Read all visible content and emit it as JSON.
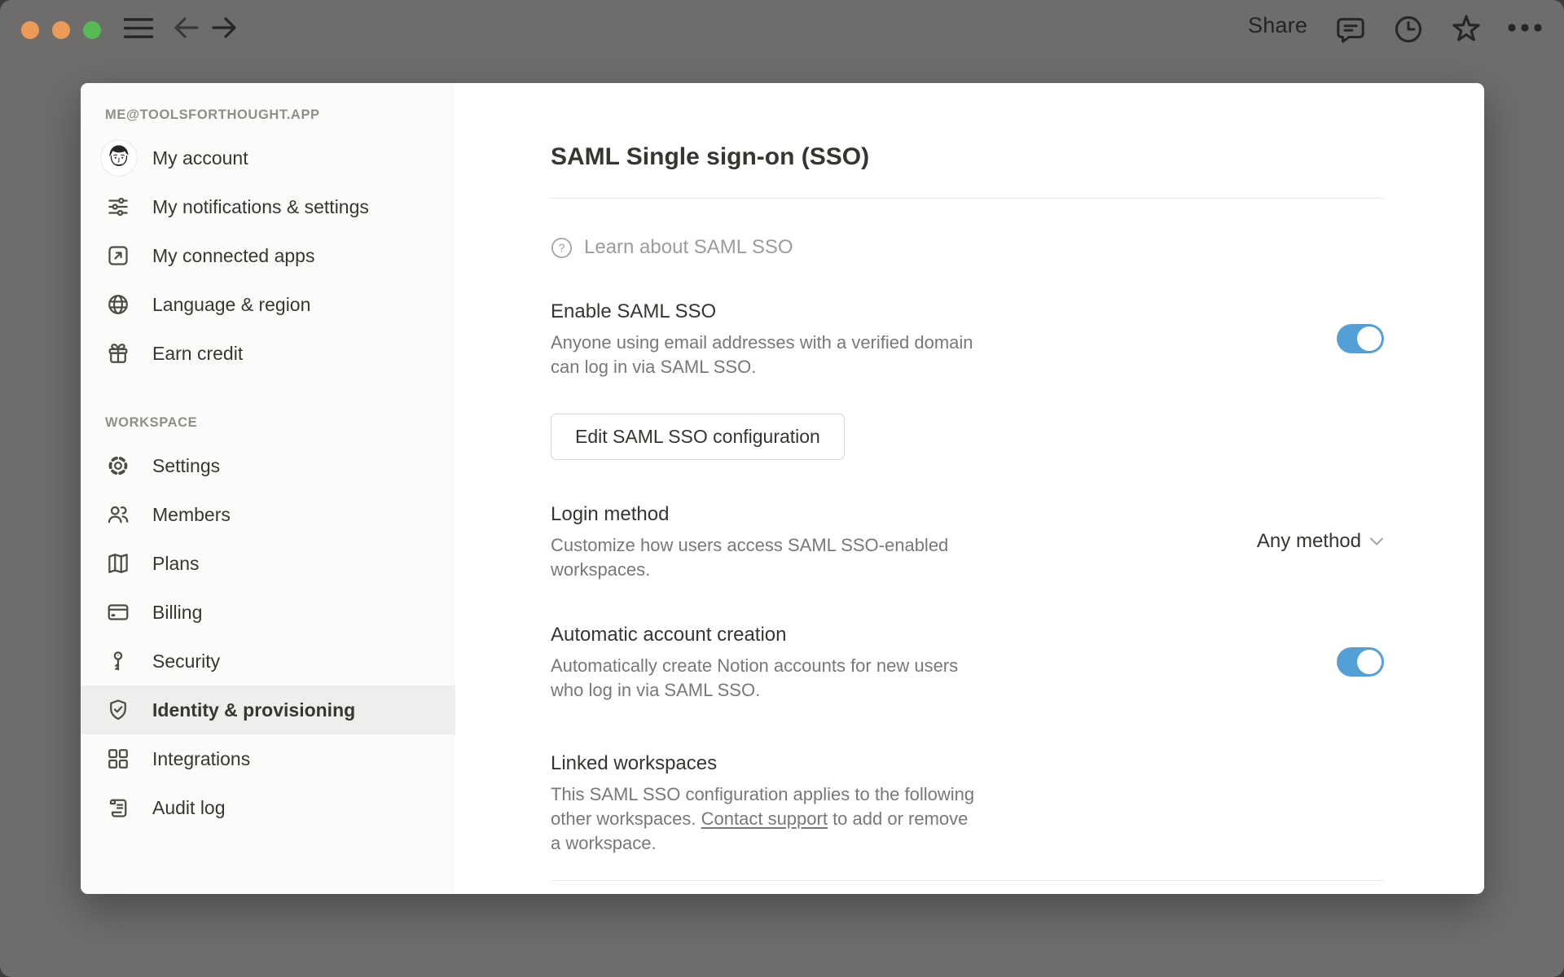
{
  "titlebar": {
    "share_label": "Share",
    "window_controls": [
      "close-button",
      "minimize-button",
      "zoom-button"
    ],
    "control_colors": [
      "#ec9a57",
      "#ec9a57",
      "#56bb55"
    ],
    "left_icons": [
      "menu-icon",
      "back-icon",
      "forward-icon"
    ],
    "right_icons": [
      "comments-icon",
      "history-icon",
      "favorite-icon",
      "more-icon"
    ]
  },
  "sidebar": {
    "account_section_label": "ME@TOOLSFORTHOUGHT.APP",
    "account_items": [
      {
        "label": "My account",
        "icon": "avatar"
      },
      {
        "label": "My notifications & settings",
        "icon": "sliders-icon"
      },
      {
        "label": "My connected apps",
        "icon": "arrow-up-right-box-icon"
      },
      {
        "label": "Language & region",
        "icon": "globe-icon"
      },
      {
        "label": "Earn credit",
        "icon": "gift-icon"
      }
    ],
    "workspace_section_label": "WORKSPACE",
    "workspace_items": [
      {
        "label": "Settings",
        "icon": "gear-icon"
      },
      {
        "label": "Members",
        "icon": "people-icon"
      },
      {
        "label": "Plans",
        "icon": "map-icon"
      },
      {
        "label": "Billing",
        "icon": "credit-card-icon"
      },
      {
        "label": "Security",
        "icon": "key-icon"
      },
      {
        "label": "Identity & provisioning",
        "icon": "shield-check-icon",
        "selected": true
      },
      {
        "label": "Integrations",
        "icon": "grid-icon"
      },
      {
        "label": "Audit log",
        "icon": "scroll-icon"
      }
    ]
  },
  "main": {
    "title": "SAML Single sign-on (SSO)",
    "learn_link": "Learn about SAML SSO",
    "enable": {
      "title": "Enable SAML SSO",
      "description_lines": [
        "Anyone using email addresses with a verified domain",
        "can log in via SAML SSO."
      ],
      "toggle_on": true
    },
    "edit_button_label": "Edit SAML SSO configuration",
    "login_method": {
      "title": "Login method",
      "description_lines": [
        "Customize how users access SAML SSO-enabled",
        "workspaces."
      ],
      "value": "Any method"
    },
    "auto_account": {
      "title": "Automatic account creation",
      "description_lines": [
        "Automatically create Notion accounts for new users",
        "who log in via SAML SSO."
      ],
      "toggle_on": true
    },
    "linked_workspaces": {
      "title": "Linked workspaces",
      "text_before": "This SAML SSO configuration applies to the following\nother workspaces. ",
      "link_text": "Contact support",
      "text_after": " to add or remove\na workspace."
    }
  },
  "colors": {
    "toggle_on": "#54a0d6",
    "sidebar_bg": "#fbfbfa",
    "selected_row_bg": "#efeeec",
    "backdrop": "#6e6d6b",
    "heading_text": "#37352f",
    "muted_text": "#7a7874"
  }
}
